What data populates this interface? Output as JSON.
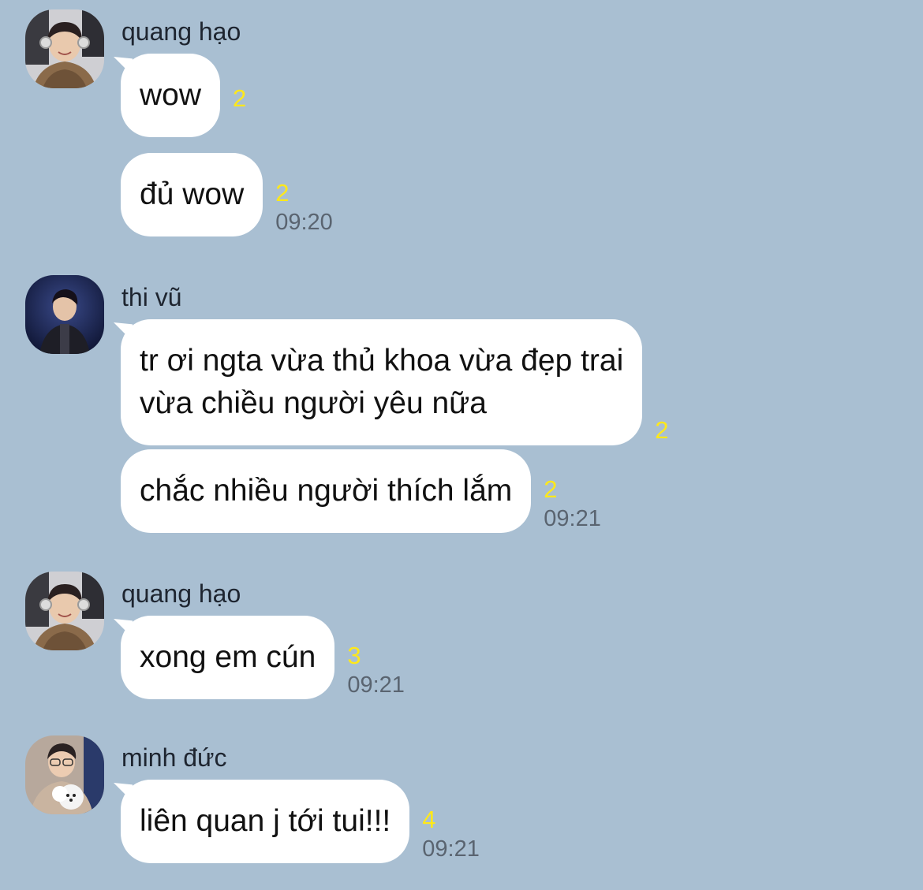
{
  "messages": [
    {
      "sender": "quang hạo",
      "avatar": "avatar-quang-hao",
      "bubbles": [
        {
          "text": "wow",
          "unread": "2",
          "time": ""
        },
        {
          "text": "đủ wow",
          "unread": "2",
          "time": "09:20"
        }
      ]
    },
    {
      "sender": "thi vũ",
      "avatar": "avatar-thi-vu",
      "bubbles": [
        {
          "text": "tr ơi ngta vừa thủ khoa vừa đẹp trai\nvừa chiều người yêu nữa",
          "unread": "2",
          "time": ""
        },
        {
          "text": "chắc nhiều người thích lắm",
          "unread": "2",
          "time": "09:21"
        }
      ]
    },
    {
      "sender": "quang hạo",
      "avatar": "avatar-quang-hao",
      "bubbles": [
        {
          "text": "xong em cún",
          "unread": "3",
          "time": "09:21"
        }
      ]
    },
    {
      "sender": "minh đức",
      "avatar": "avatar-minh-duc",
      "bubbles": [
        {
          "text": "liên quan j tới tui!!!",
          "unread": "4",
          "time": "09:21"
        }
      ]
    }
  ],
  "colors": {
    "background": "#a9bfd2",
    "bubble": "#ffffff",
    "unread": "#ffe81a",
    "time": "#5a6470"
  }
}
